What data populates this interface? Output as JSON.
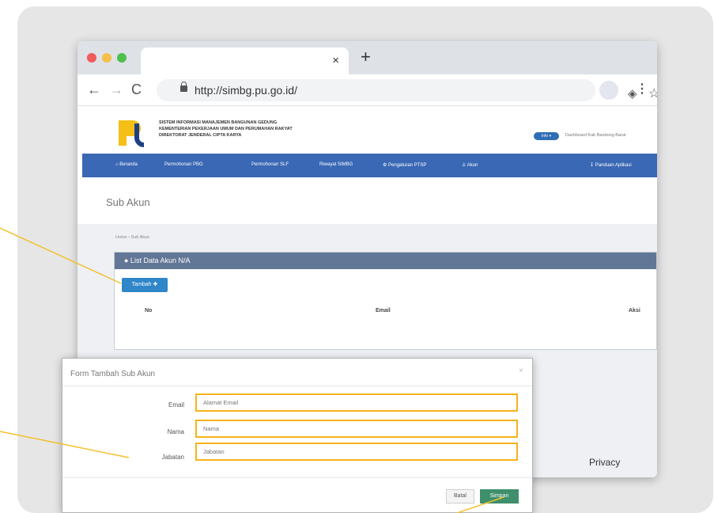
{
  "browser": {
    "tab_close": "×",
    "new_tab": "+",
    "back": "←",
    "forward": "→",
    "reload": "C",
    "url": "http://simbg.pu.go.id/",
    "extension_icon": "◈",
    "star_icon": "☆",
    "menu_icon": "⋮"
  },
  "site": {
    "name_lines": [
      "SISTEM INFORMASI MANAJEMEN BANGUNAN GEDUNG",
      "KEMENTERIAN PEKERJAAN UMUM DAN PERUMAHAN RAKYAT",
      "DIREKTORAT JENDERAL CIPTA KARYA"
    ],
    "info_badge": "Info ▾",
    "user_text": "Dashboard Kab Bandung Barat",
    "nav_items": [
      "⌂ Beranda",
      "Permohonan PBG",
      "Permohonan SLF",
      "Riwayat SIMBG",
      "⚙ Pengaturan PTSP",
      "♙ Akun",
      "↧ Panduan Aplikasi"
    ]
  },
  "page": {
    "title": "Sub Akun",
    "breadcrumb": "Home › Sub Akun",
    "card_title": "● List Data Akun N/A",
    "add_button": "Tambah ✚",
    "columns": [
      "No",
      "Email",
      "Aksi"
    ]
  },
  "footer": {
    "privacy": "Privacy"
  },
  "modal": {
    "title": "Form Tambah Sub Akun",
    "close": "×",
    "fields": [
      {
        "label": "Email",
        "placeholder": "Alamat Email"
      },
      {
        "label": "Nama",
        "placeholder": "Nama"
      },
      {
        "label": "Jabatan",
        "placeholder": "Jabatan"
      }
    ],
    "cancel_button": "Batal",
    "save_button": "Simpan"
  },
  "colors": {
    "navbar": "#3a68b4",
    "card_header": "#627796",
    "add_button": "#2f86c8",
    "highlight": "#f6b21b",
    "save_button": "#3f8f6c",
    "callout_line": "#f3c12b"
  }
}
